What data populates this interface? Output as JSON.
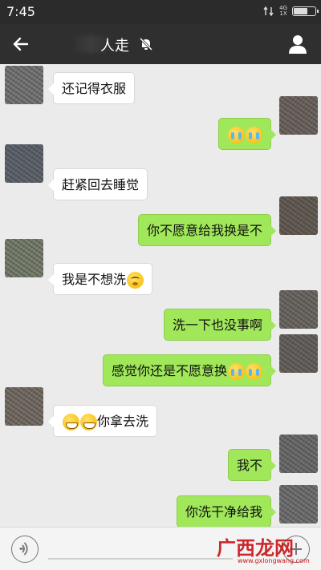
{
  "status_bar": {
    "time": "7:45",
    "network": "4G",
    "network_sub": "1X"
  },
  "header": {
    "title": "人走",
    "back_icon": "arrow-left-icon",
    "mute_icon": "bell-muted-icon",
    "profile_icon": "person-icon"
  },
  "messages": [
    {
      "side": "left",
      "text": "还记得衣服",
      "emojis": []
    },
    {
      "side": "right",
      "text": "",
      "emojis": [
        "cry",
        "cry"
      ]
    },
    {
      "side": "left",
      "text": "赶紧回去睡觉",
      "emojis": []
    },
    {
      "side": "right",
      "text": "你不愿意给我换是不",
      "emojis": []
    },
    {
      "side": "left",
      "text": "我是不想洗",
      "emojis": [
        "dizzy"
      ]
    },
    {
      "side": "right",
      "text": "洗一下也没事啊",
      "emojis": []
    },
    {
      "side": "right",
      "text": "感觉你还是不愿意换",
      "emojis": [
        "cry",
        "cry"
      ]
    },
    {
      "side": "left",
      "text": "你拿去洗",
      "emojis": [
        "grin",
        "grin"
      ],
      "emoji_first": true
    },
    {
      "side": "right",
      "text": "我不",
      "emojis": []
    },
    {
      "side": "right",
      "text": "你洗干净给我",
      "emojis": []
    }
  ],
  "input_bar": {
    "voice_icon": "voice-icon",
    "plus_icon": "plus-icon"
  },
  "watermark": {
    "text": "广西龙网",
    "url": "www.gxlongwang.com"
  },
  "colors": {
    "status_bar": "#2b2b2b",
    "title_bar": "#2f2f2f",
    "chat_bg": "#ebebeb",
    "bubble_right": "#a0e75a",
    "bubble_left": "#ffffff",
    "watermark": "#c9161c"
  }
}
